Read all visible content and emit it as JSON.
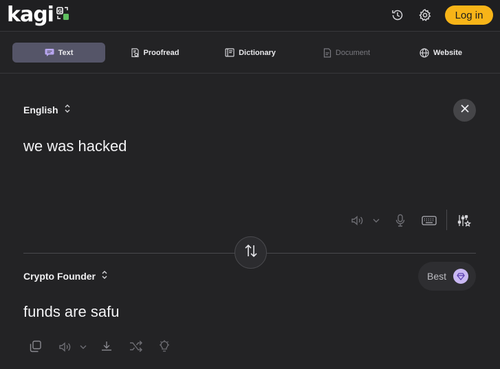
{
  "app": {
    "logo_text": "kagi"
  },
  "header": {
    "history_icon": "history-icon",
    "settings_icon": "gear-icon",
    "login_label": "Log in",
    "accent_color": "#f7b418"
  },
  "tabs": [
    {
      "label": "Text",
      "icon": "chat-bubble-icon",
      "active": true
    },
    {
      "label": "Proofread",
      "icon": "proofread-icon",
      "active": false
    },
    {
      "label": "Dictionary",
      "icon": "book-icon",
      "active": false
    },
    {
      "label": "Document",
      "icon": "document-icon",
      "active": false,
      "disabled": true
    },
    {
      "label": "Website",
      "icon": "globe-icon",
      "active": false
    }
  ],
  "source": {
    "language": "English",
    "text": "we was hacked"
  },
  "target": {
    "language": "Crypto Founder",
    "text": "funds are safu",
    "quality_label": "Best"
  }
}
